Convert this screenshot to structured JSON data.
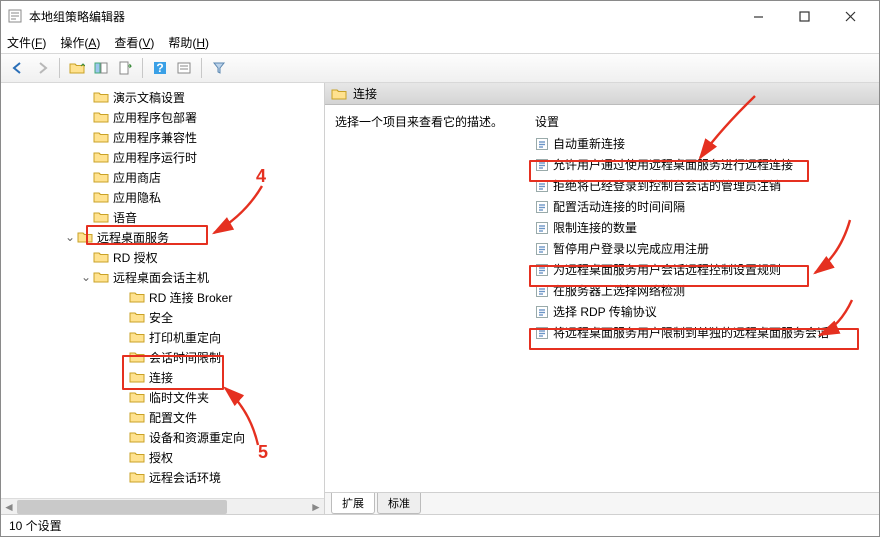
{
  "window": {
    "title": "本地组策略编辑器"
  },
  "menu": {
    "file": "文件(F)",
    "action": "操作(A)",
    "view": "查看(V)",
    "help": "帮助(H)"
  },
  "tree": {
    "items": [
      {
        "label": "演示文稿设置",
        "indent": "a"
      },
      {
        "label": "应用程序包部署",
        "indent": "a"
      },
      {
        "label": "应用程序兼容性",
        "indent": "a"
      },
      {
        "label": "应用程序运行时",
        "indent": "a"
      },
      {
        "label": "应用商店",
        "indent": "a"
      },
      {
        "label": "应用隐私",
        "indent": "a"
      },
      {
        "label": "语音",
        "indent": "a"
      },
      {
        "label": "远程桌面服务",
        "indent": "b",
        "expander": "v"
      },
      {
        "label": "RD 授权",
        "indent": "c"
      },
      {
        "label": "远程桌面会话主机",
        "indent": "c",
        "expander": "v"
      },
      {
        "label": "RD 连接 Broker",
        "indent": "e"
      },
      {
        "label": "安全",
        "indent": "e"
      },
      {
        "label": "打印机重定向",
        "indent": "e"
      },
      {
        "label": "会话时间限制",
        "indent": "e"
      },
      {
        "label": "连接",
        "indent": "e",
        "selected": true
      },
      {
        "label": "临时文件夹",
        "indent": "e"
      },
      {
        "label": "配置文件",
        "indent": "e"
      },
      {
        "label": "设备和资源重定向",
        "indent": "e"
      },
      {
        "label": "授权",
        "indent": "e"
      },
      {
        "label": "远程会话环境",
        "indent": "e"
      }
    ]
  },
  "right": {
    "header": "连接",
    "desc": "选择一个项目来查看它的描述。",
    "settings_header": "设置",
    "settings": [
      "自动重新连接",
      "允许用户通过使用远程桌面服务进行远程连接",
      "拒绝将已经登录到控制台会话的管理员注销",
      "配置活动连接的时间间隔",
      "限制连接的数量",
      "暂停用户登录以完成应用注册",
      "为远程桌面服务用户会话远程控制设置规则",
      "在服务器上选择网络检测",
      "选择 RDP 传输协议",
      "将远程桌面服务用户限制到单独的远程桌面服务会话"
    ]
  },
  "tabs": {
    "extended": "扩展",
    "standard": "标准"
  },
  "statusbar": "10 个设置",
  "annotations": {
    "n4": "4",
    "n5": "5"
  }
}
